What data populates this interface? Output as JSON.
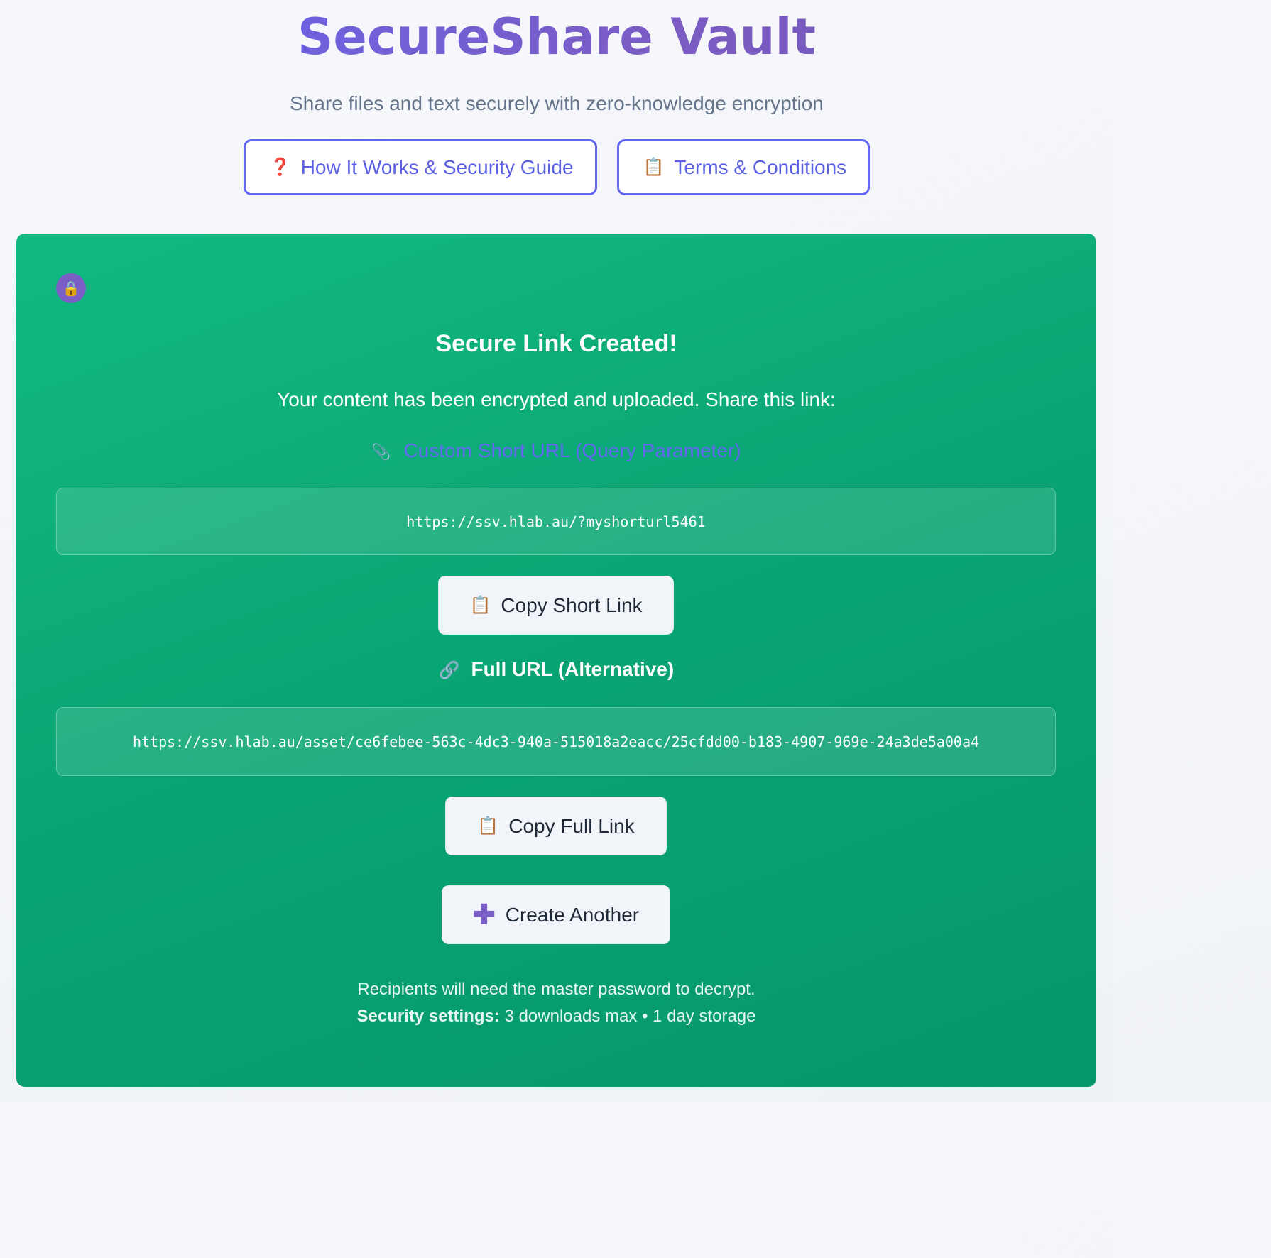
{
  "header": {
    "title": "SecureShare Vault",
    "subtitle": "Share files and text securely with zero-knowledge encryption",
    "guide_button": {
      "icon": "question-mark-icon",
      "glyph": "❓",
      "label": "How It Works & Security Guide"
    },
    "terms_button": {
      "icon": "clipboard-icon",
      "glyph": "📋",
      "label": "Terms & Conditions"
    }
  },
  "card": {
    "badge": {
      "icon": "lock-icon",
      "glyph": "🔒"
    },
    "title": "Secure Link Created!",
    "message": "Your content has been encrypted and uploaded. Share this link:",
    "short_section": {
      "icon": "paperclip-icon",
      "glyph": "📎",
      "heading": "Custom Short URL (Query Parameter)",
      "url": "https://ssv.hlab.au/?myshorturl5461",
      "copy_button": {
        "icon": "clipboard-icon",
        "glyph": "📋",
        "label": "Copy Short Link"
      }
    },
    "full_section": {
      "icon": "link-icon",
      "glyph": "🔗",
      "heading": "Full URL (Alternative)",
      "url": "https://ssv.hlab.au/asset/ce6febee-563c-4dc3-940a-515018a2eacc/25cfdd00-b183-4907-969e-24a3de5a00a4",
      "copy_button": {
        "icon": "clipboard-icon",
        "glyph": "📋",
        "label": "Copy Full Link"
      }
    },
    "create_button": {
      "icon": "plus-icon",
      "glyph": "✚",
      "label": "Create Another"
    },
    "footnote": {
      "line1": "Recipients will need the master password to decrypt.",
      "settings_label": "Security settings:",
      "settings_value": "3 downloads max • 1 day storage"
    }
  },
  "colors": {
    "accent": "#6366f1",
    "card_green": "#10b981",
    "button_bg": "#f1f5f9"
  }
}
